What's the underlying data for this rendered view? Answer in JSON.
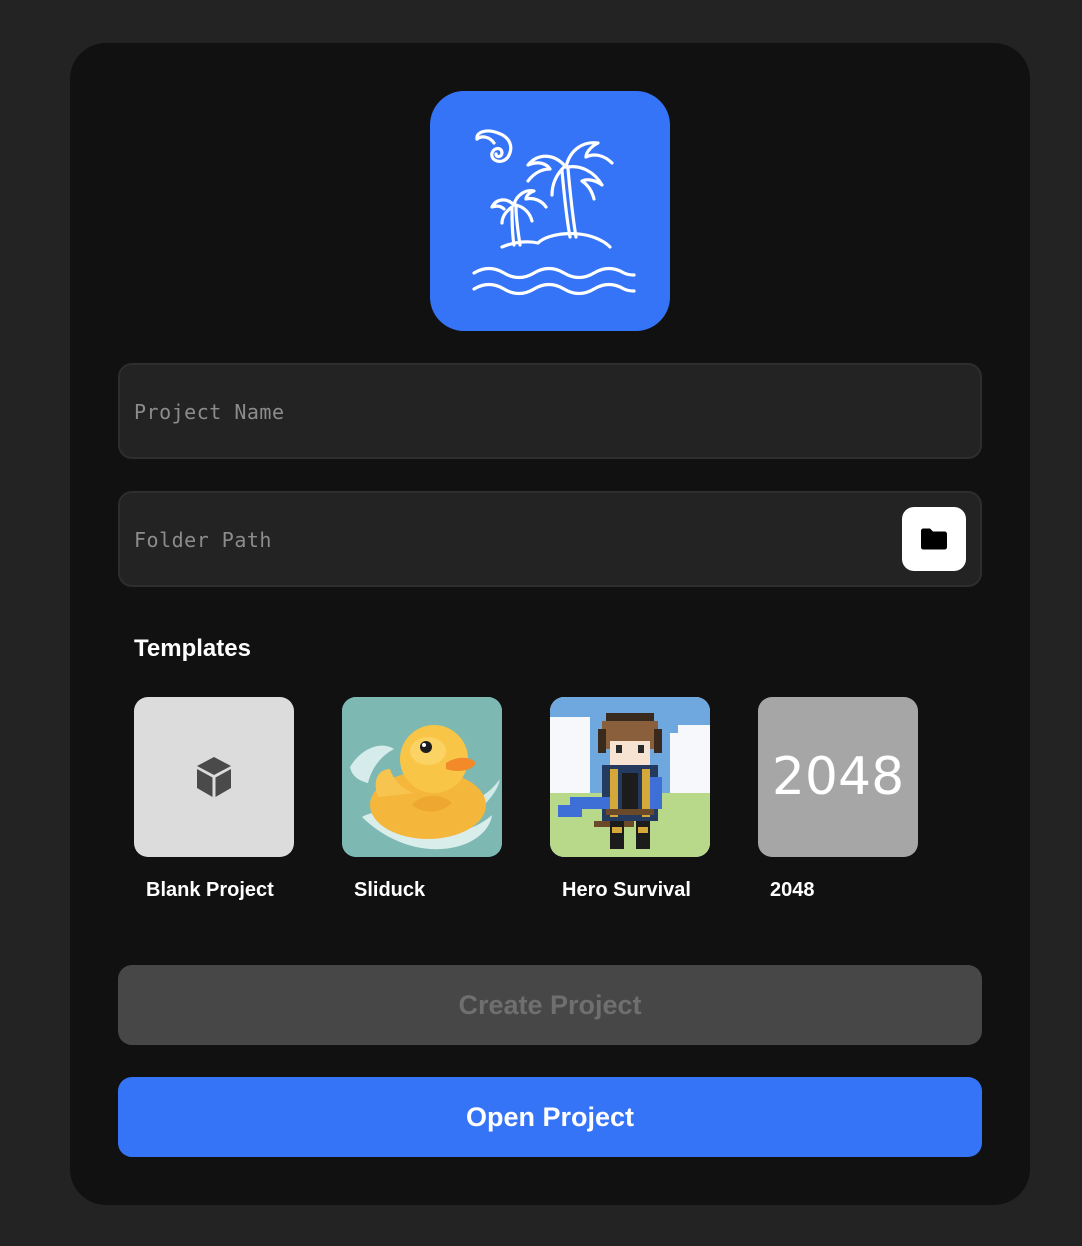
{
  "theme": {
    "background": "#232323",
    "panel": "#111111",
    "accent": "#3674f7",
    "disabled_button": "#474747",
    "disabled_text": "#6f6f6f"
  },
  "logo": {
    "icon": "palm-island-icon"
  },
  "form": {
    "project_name": {
      "value": "",
      "placeholder": "Project Name"
    },
    "folder_path": {
      "value": "",
      "placeholder": "Folder Path",
      "browse_icon": "folder-icon"
    }
  },
  "templates": {
    "title": "Templates",
    "items": [
      {
        "label": "Blank Project",
        "icon": "cube-icon"
      },
      {
        "label": "Sliduck",
        "icon": "rubber-duck-image"
      },
      {
        "label": "Hero Survival",
        "icon": "pixel-hero-image"
      },
      {
        "label": "2048",
        "thumb_text": "2048"
      }
    ]
  },
  "actions": {
    "create_label": "Create Project",
    "create_enabled": false,
    "open_label": "Open Project"
  }
}
